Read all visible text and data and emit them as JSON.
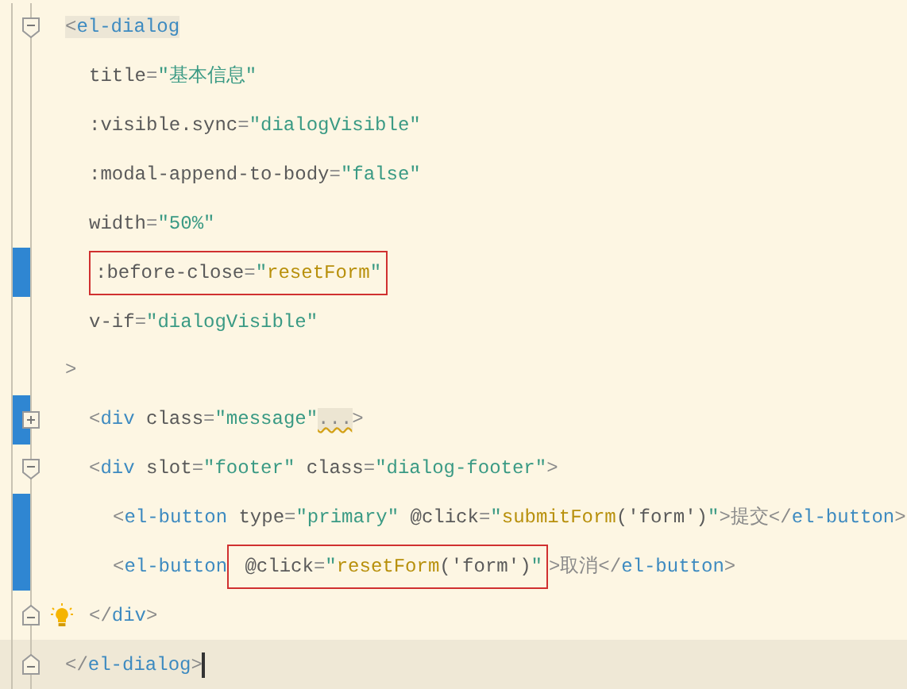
{
  "editor": {
    "lines": [
      {
        "fold": {
          "kind": "collapse"
        },
        "changed": false,
        "tokens": [
          {
            "kind": "punct",
            "text": "<",
            "matched": true
          },
          {
            "kind": "tag",
            "text": "el-dialog",
            "matched": true
          }
        ],
        "children": [
          {
            "changed": false,
            "tokens": [
              {
                "kind": "attr",
                "text": "title"
              },
              {
                "kind": "punct",
                "text": "="
              },
              {
                "kind": "str",
                "text": "\"基本信息\""
              }
            ]
          },
          {
            "changed": false,
            "tokens": [
              {
                "kind": "attr",
                "text": ":visible.sync"
              },
              {
                "kind": "punct",
                "text": "="
              },
              {
                "kind": "str",
                "text": "\"dialogVisible\""
              }
            ]
          },
          {
            "changed": false,
            "tokens": [
              {
                "kind": "attr",
                "text": ":modal-append-to-body"
              },
              {
                "kind": "punct",
                "text": "="
              },
              {
                "kind": "str",
                "text": "\"false\""
              }
            ]
          },
          {
            "changed": false,
            "tokens": [
              {
                "kind": "attr",
                "text": "width"
              },
              {
                "kind": "punct",
                "text": "="
              },
              {
                "kind": "str",
                "text": "\"50%\""
              }
            ]
          },
          {
            "changed": true,
            "tokens": [
              {
                "kind": "box",
                "tokens": [
                  {
                    "kind": "attr",
                    "text": ":before-close"
                  },
                  {
                    "kind": "punct",
                    "text": "="
                  },
                  {
                    "kind": "str",
                    "text": "\""
                  },
                  {
                    "kind": "call",
                    "text": "resetForm"
                  },
                  {
                    "kind": "str",
                    "text": "\""
                  }
                ]
              }
            ]
          },
          {
            "changed": false,
            "tokens": [
              {
                "kind": "attr",
                "text": "v-if"
              },
              {
                "kind": "punct",
                "text": "="
              },
              {
                "kind": "str",
                "text": "\"dialogVisible\""
              }
            ]
          }
        ]
      },
      {
        "changed": false,
        "tokens": [
          {
            "kind": "punct",
            "text": ">"
          }
        ],
        "children": [
          {
            "fold": {
              "kind": "expand"
            },
            "changed": true,
            "tokens": [
              {
                "kind": "punct",
                "text": "<"
              },
              {
                "kind": "tag",
                "text": "div"
              },
              {
                "kind": "attr",
                "text": " class"
              },
              {
                "kind": "punct",
                "text": "="
              },
              {
                "kind": "str",
                "text": "\"message\""
              },
              {
                "kind": "folded",
                "text": "..."
              },
              {
                "kind": "punct",
                "text": ">"
              }
            ]
          },
          {
            "fold": {
              "kind": "collapse"
            },
            "changed": false,
            "tokens": [
              {
                "kind": "punct",
                "text": "<"
              },
              {
                "kind": "tag",
                "text": "div"
              },
              {
                "kind": "attr",
                "text": " slot"
              },
              {
                "kind": "punct",
                "text": "="
              },
              {
                "kind": "str",
                "text": "\"footer\""
              },
              {
                "kind": "attr",
                "text": " class"
              },
              {
                "kind": "punct",
                "text": "="
              },
              {
                "kind": "str",
                "text": "\"dialog-footer\""
              },
              {
                "kind": "punct",
                "text": ">"
              }
            ],
            "children": [
              {
                "changed": true,
                "tokens": [
                  {
                    "kind": "punct",
                    "text": "<"
                  },
                  {
                    "kind": "tag",
                    "text": "el-button"
                  },
                  {
                    "kind": "attr",
                    "text": " type"
                  },
                  {
                    "kind": "punct",
                    "text": "="
                  },
                  {
                    "kind": "str",
                    "text": "\"primary\""
                  },
                  {
                    "kind": "attr",
                    "text": " @click"
                  },
                  {
                    "kind": "punct",
                    "text": "="
                  },
                  {
                    "kind": "str",
                    "text": "\""
                  },
                  {
                    "kind": "call",
                    "text": "submitForm"
                  },
                  {
                    "kind": "attr",
                    "text": "('form')"
                  },
                  {
                    "kind": "str",
                    "text": "\""
                  },
                  {
                    "kind": "punct",
                    "text": ">提交</"
                  },
                  {
                    "kind": "tag",
                    "text": "el-button"
                  },
                  {
                    "kind": "punct",
                    "text": ">"
                  }
                ]
              },
              {
                "changed": true,
                "tokens": [
                  {
                    "kind": "punct",
                    "text": "<"
                  },
                  {
                    "kind": "tag",
                    "text": "el-button"
                  },
                  {
                    "kind": "box",
                    "tokens": [
                      {
                        "kind": "attr",
                        "text": " @click"
                      },
                      {
                        "kind": "punct",
                        "text": "="
                      },
                      {
                        "kind": "str",
                        "text": "\""
                      },
                      {
                        "kind": "call",
                        "text": "resetForm"
                      },
                      {
                        "kind": "attr",
                        "text": "('form')"
                      },
                      {
                        "kind": "str",
                        "text": "\""
                      }
                    ]
                  },
                  {
                    "kind": "punct",
                    "text": ">取消</"
                  },
                  {
                    "kind": "tag",
                    "text": "el-button"
                  },
                  {
                    "kind": "punct",
                    "text": ">"
                  }
                ]
              }
            ]
          },
          {
            "fold": {
              "kind": "end"
            },
            "bulb": true,
            "changed": false,
            "tokens": [
              {
                "kind": "punct",
                "text": "</"
              },
              {
                "kind": "tag",
                "text": "div"
              },
              {
                "kind": "punct",
                "text": ">"
              }
            ]
          }
        ]
      },
      {
        "fold": {
          "kind": "end"
        },
        "current": true,
        "changed": false,
        "tokens": [
          {
            "kind": "punct",
            "text": "</"
          },
          {
            "kind": "tag",
            "text": "el-dialog"
          },
          {
            "kind": "punct",
            "text": ">"
          }
        ]
      }
    ]
  }
}
